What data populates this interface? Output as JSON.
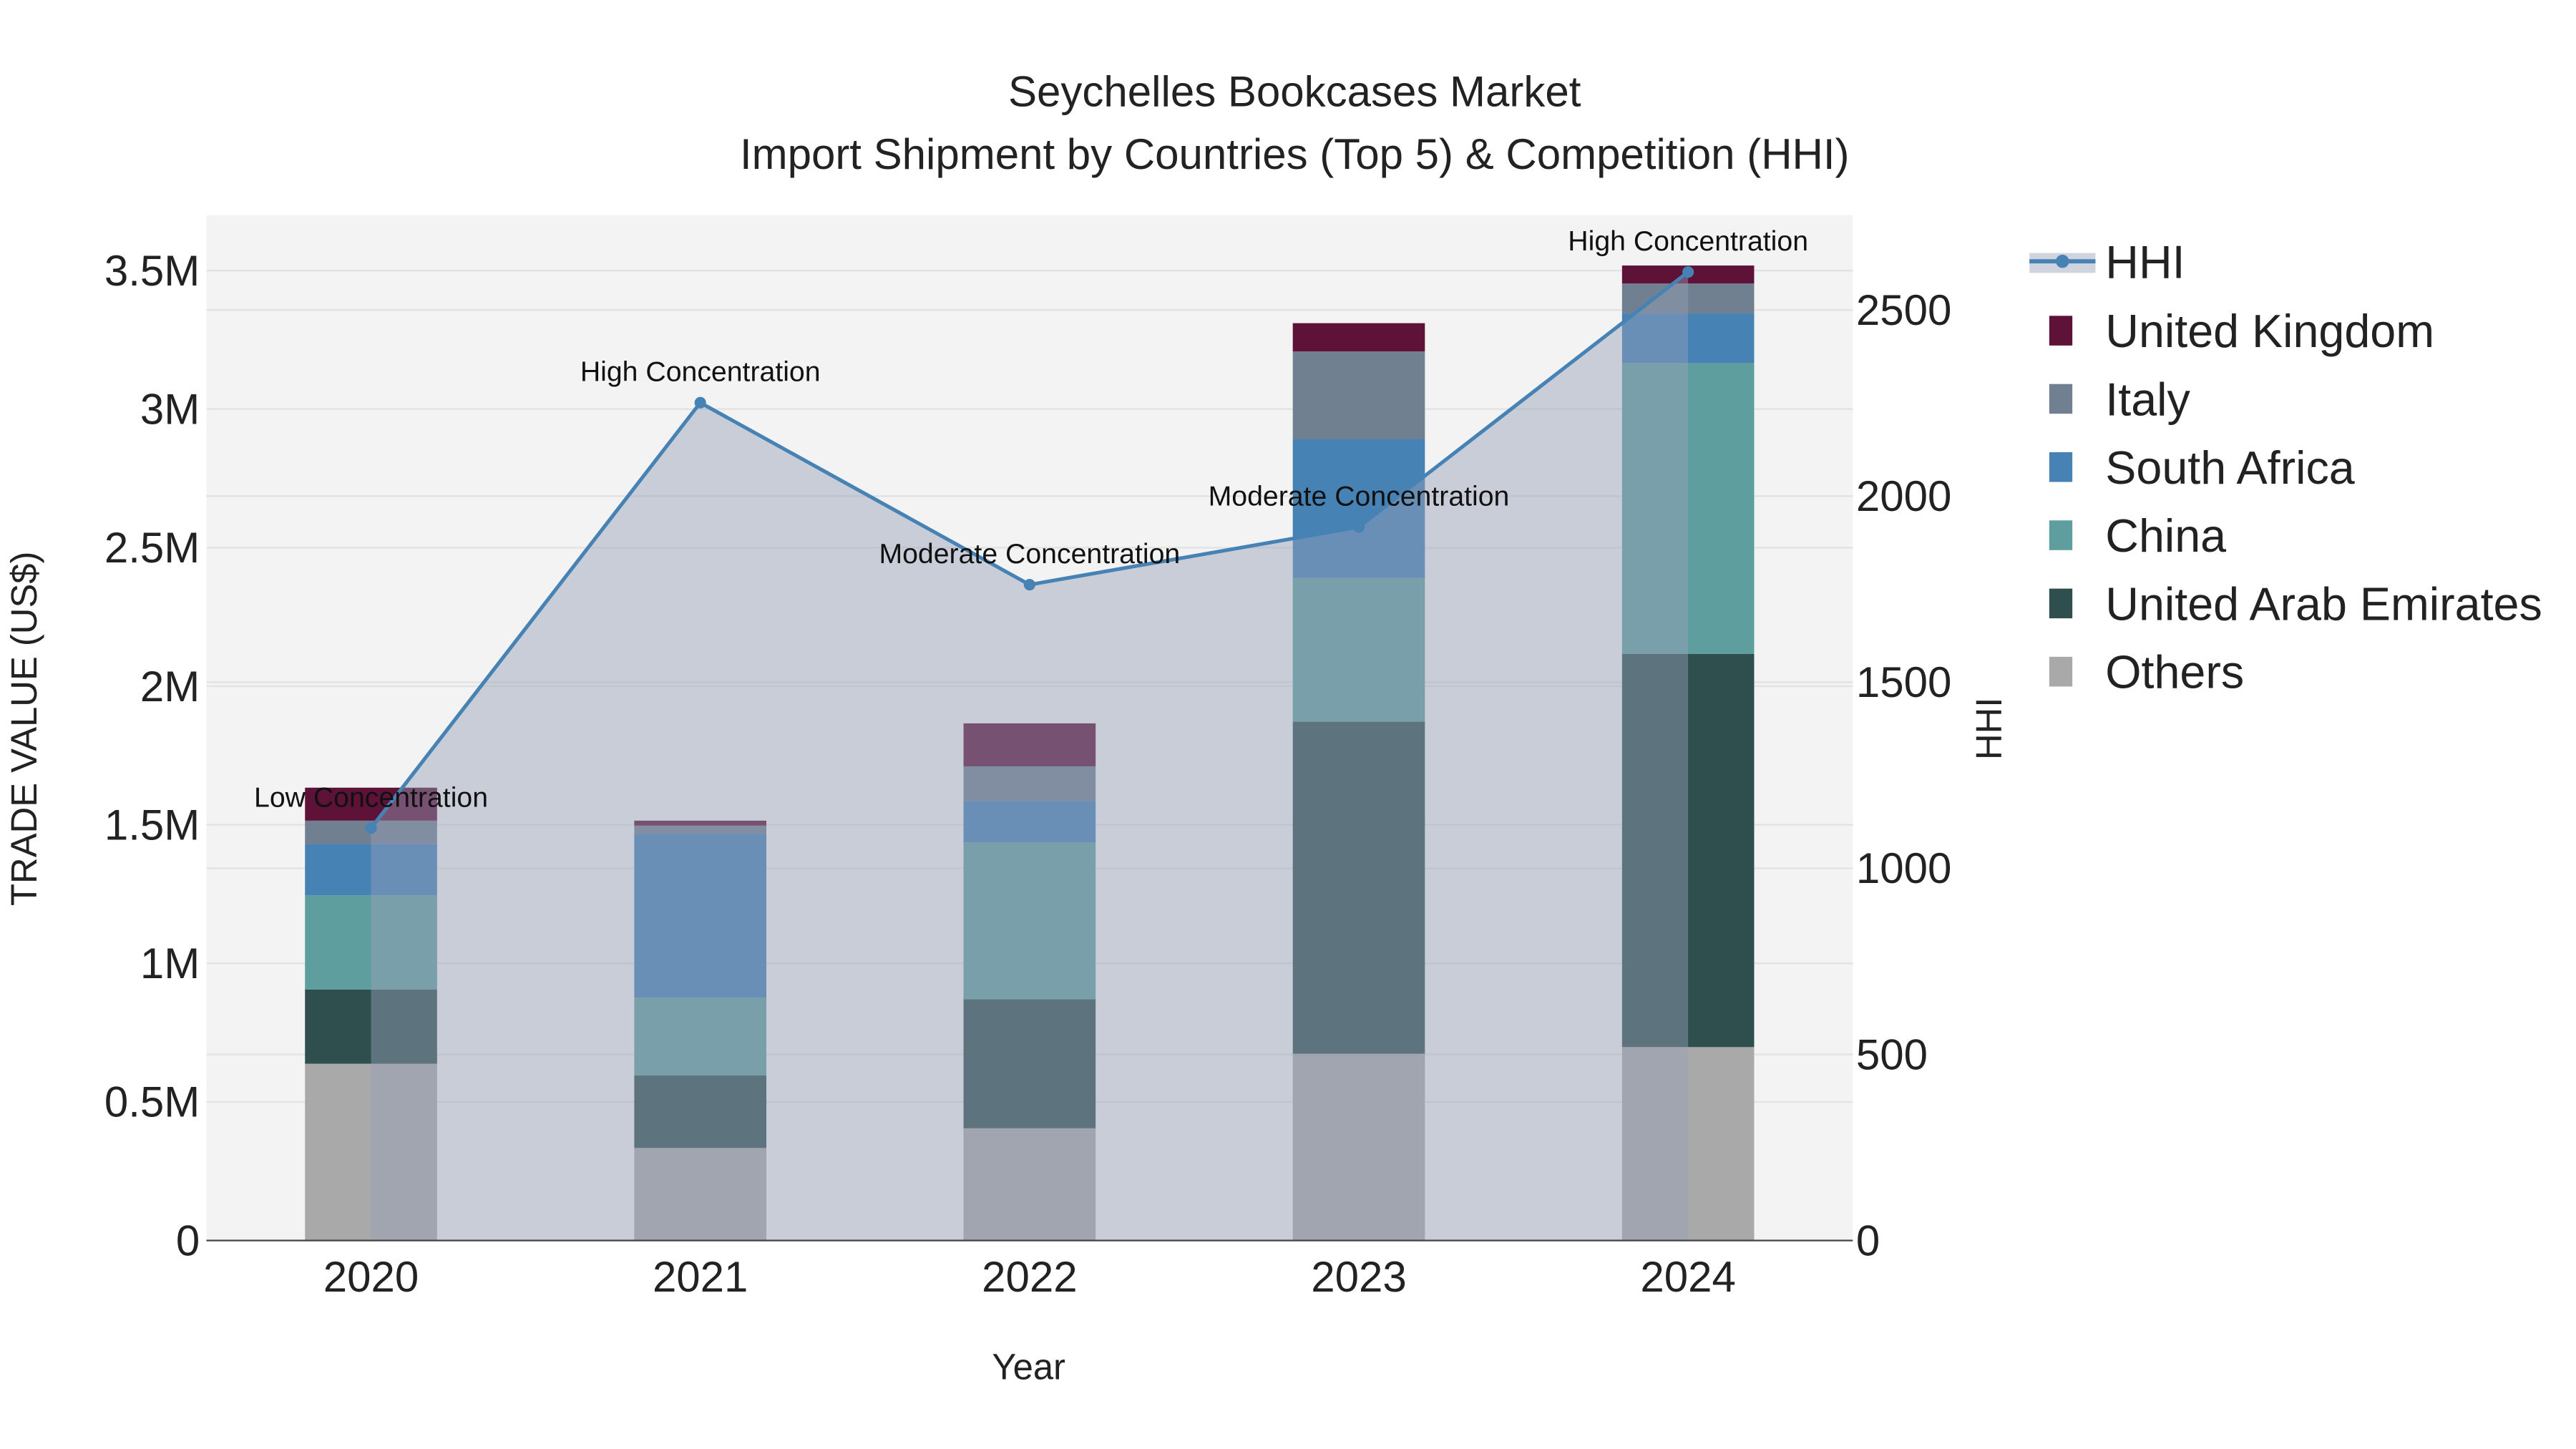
{
  "chart_data": {
    "type": "bar",
    "title": "Seychelles Bookcases Market",
    "subtitle": "Import Shipment by Countries (Top 5) & Competition (HHI)",
    "xlabel": "Year",
    "ylabel": "TRADE VALUE (US$)",
    "y2label": "HHI",
    "categories": [
      "2020",
      "2021",
      "2022",
      "2023",
      "2024"
    ],
    "ylim": [
      0,
      3700000
    ],
    "y2lim": [
      0,
      2755
    ],
    "yticks": [
      {
        "v": 0,
        "label": "0"
      },
      {
        "v": 500000,
        "label": "0.5M"
      },
      {
        "v": 1000000,
        "label": "1M"
      },
      {
        "v": 1500000,
        "label": "1.5M"
      },
      {
        "v": 2000000,
        "label": "2M"
      },
      {
        "v": 2500000,
        "label": "2.5M"
      },
      {
        "v": 3000000,
        "label": "3M"
      },
      {
        "v": 3500000,
        "label": "3.5M"
      }
    ],
    "y2ticks": [
      {
        "v": 0,
        "label": "0"
      },
      {
        "v": 500,
        "label": "500"
      },
      {
        "v": 1000,
        "label": "1000"
      },
      {
        "v": 1500,
        "label": "1500"
      },
      {
        "v": 2000,
        "label": "2000"
      },
      {
        "v": 2500,
        "label": "2500"
      }
    ],
    "grid": true,
    "legend_position": "right",
    "series": [
      {
        "name": "Others",
        "color": "#a9a9a9",
        "values": [
          638000,
          334000,
          405000,
          674000,
          698000
        ]
      },
      {
        "name": "United Arab Emirates",
        "color": "#2f4f4f",
        "values": [
          268000,
          262000,
          466000,
          1198000,
          1419000
        ]
      },
      {
        "name": "China",
        "color": "#5f9e9e",
        "values": [
          340000,
          281000,
          566000,
          519000,
          1049000
        ]
      },
      {
        "name": "South Africa",
        "color": "#4682b4",
        "values": [
          185000,
          590000,
          149000,
          501000,
          179000
        ]
      },
      {
        "name": "Italy",
        "color": "#708090",
        "values": [
          84000,
          30000,
          125000,
          316000,
          108000
        ]
      },
      {
        "name": "United Kingdom",
        "color": "#5e1238",
        "values": [
          119000,
          18000,
          155000,
          102000,
          65000
        ]
      }
    ],
    "hhi": {
      "name": "HHI",
      "color": "#4682b4",
      "values": [
        1108,
        2251,
        1762,
        1917,
        2602
      ],
      "annotations": [
        "Low Concentration",
        "High Concentration",
        "Moderate Concentration",
        "Moderate Concentration",
        "High Concentration"
      ]
    }
  }
}
